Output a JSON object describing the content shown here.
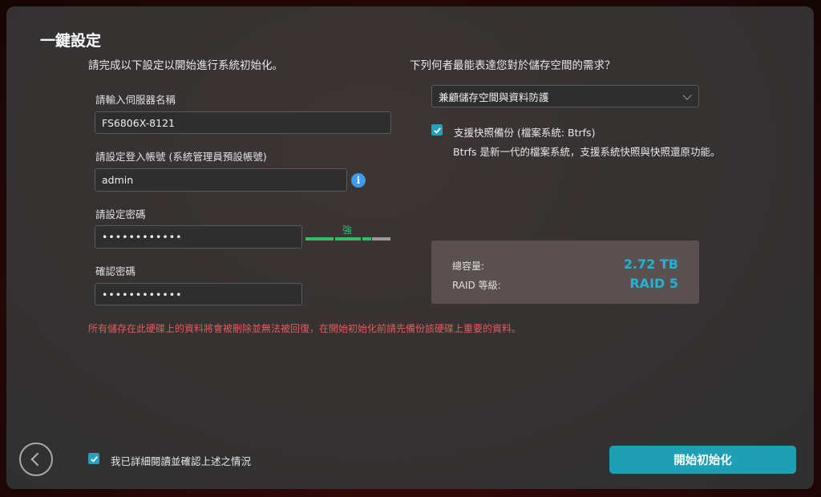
{
  "page": {
    "title": "一鍵設定",
    "subtitle_left": "請完成以下設定以開始進行系統初始化。",
    "subtitle_right": "下列何者最能表達您對於儲存空間的需求？"
  },
  "form": {
    "server_name_label": "請輸入伺服器名稱",
    "server_name_value": "FS6806X-8121",
    "account_label": "請設定登入帳號 (系統管理員預設帳號)",
    "account_value": "admin",
    "info_icon": "info-icon",
    "password_label": "請設定密碼",
    "password_value": "••••••••••••",
    "password_strength": "強",
    "strength_colors": {
      "active": "#2fbf6a",
      "inactive": "#9a9a9a"
    },
    "confirm_label": "確認密碼",
    "confirm_value": "••••••••••••",
    "warning": "所有儲存在此硬碟上的資料將會被刪除並無法被回復，在開始初始化前請先備份該硬碟上重要的資料。"
  },
  "storage": {
    "selected_option": "兼顧儲存空間與資料防護",
    "snapshot_checked": true,
    "snapshot_label": "支援快照備份 (檔案系統: Btrfs)",
    "snapshot_desc": "Btrfs 是新一代的檔案系統，支援系統快照與快照還原功能。",
    "summary": {
      "capacity_label": "總容量:",
      "capacity_value": "2.72 TB",
      "raid_label": "RAID 等級:",
      "raid_value": "RAID 5"
    }
  },
  "footer": {
    "confirm_checked": true,
    "confirm_label": "我已詳細閱讀並確認上述之情況",
    "start_button": "開始初始化",
    "back_icon": "chevron-left-icon"
  },
  "colors": {
    "accent": "#1f9fb3",
    "warning": "#e35b5b",
    "info": "#3d9be9",
    "summary_value": "#1fb3d4"
  }
}
